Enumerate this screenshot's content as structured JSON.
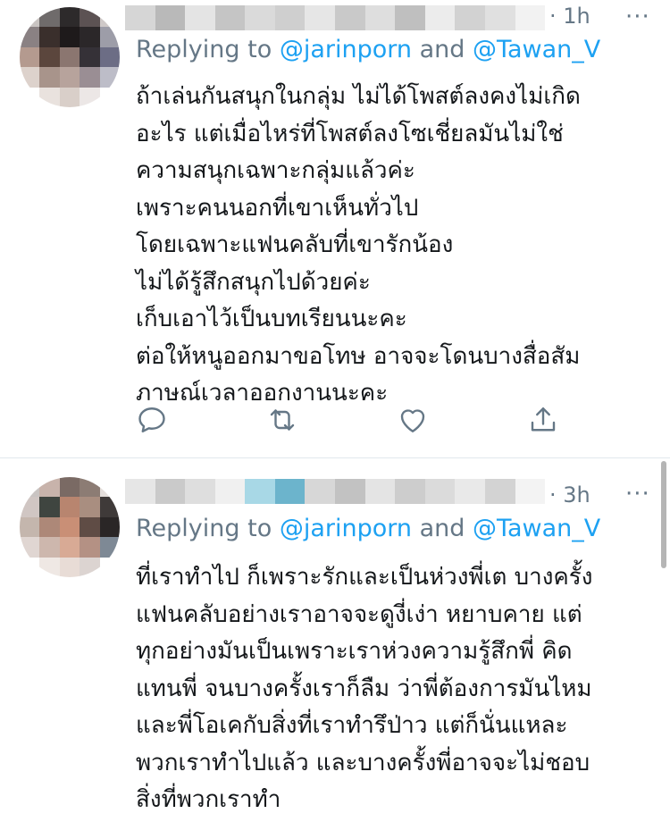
{
  "tweets": [
    {
      "time": "· 1h",
      "more": "···",
      "reply_prefix": "Replying to ",
      "mention_1": "@jarinporn",
      "reply_and": " and ",
      "mention_2": "@Tawan_V",
      "lines": [
        "ถ้าเล่นกันสนุกในกลุ่ม ไม่ได้โพสต์ลงคงไม่เกิด",
        "อะไร แต่เมื่อไหร่ที่โพสต์ลงโซเชี่ยลมันไม่ใช่",
        "ความสนุกเฉพาะกลุ่มแล้วค่ะ",
        "เพราะคนนอกที่เขาเห็นทั่วไป",
        "โดยเฉพาะแฟนคลับที่เขารักน้อง",
        "ไม่ได้รู้สึกสนุกไปด้วยค่ะ",
        "เก็บเอาไว้เป็นบทเรียนนะคะ",
        "ต่อให้หนูออกมาขอโทษ อาจจะโดนบางสื่อสัม",
        "ภาษณ์เวลาออกงานนะคะ"
      ]
    },
    {
      "time": "· 3h",
      "more": "···",
      "reply_prefix": "Replying to ",
      "mention_1": "@jarinporn",
      "reply_and": " and ",
      "mention_2": "@Tawan_V",
      "lines": [
        "ที่เราทำไป ก็เพราะรักและเป็นห่วงพี่เต บางครั้ง",
        "แฟนคลับอย่างเราอาจจะดูงี่เง่า หยาบคาย แต่",
        "ทุกอย่างมันเป็นเพราะเราห่วงความรู้สึกพี่ คิด",
        "แทนพี่ จนบางครั้งเราก็ลืม ว่าพี่ต้องการมันไหม",
        "และพี่โอเคกับสิ่งที่เราทำรึป่าว แต่ก็นั่นแหละ",
        "พวกเราทำไปแล้ว และบางครั้งพี่อาจจะไม่ชอบ",
        "สิ่งที่พวกเราทำ"
      ]
    }
  ],
  "icons": [
    "reply-icon",
    "retweet-icon",
    "like-icon",
    "share-icon"
  ],
  "colors": {
    "muted": "#657786",
    "link": "#1da1f2",
    "text": "#14171a"
  }
}
